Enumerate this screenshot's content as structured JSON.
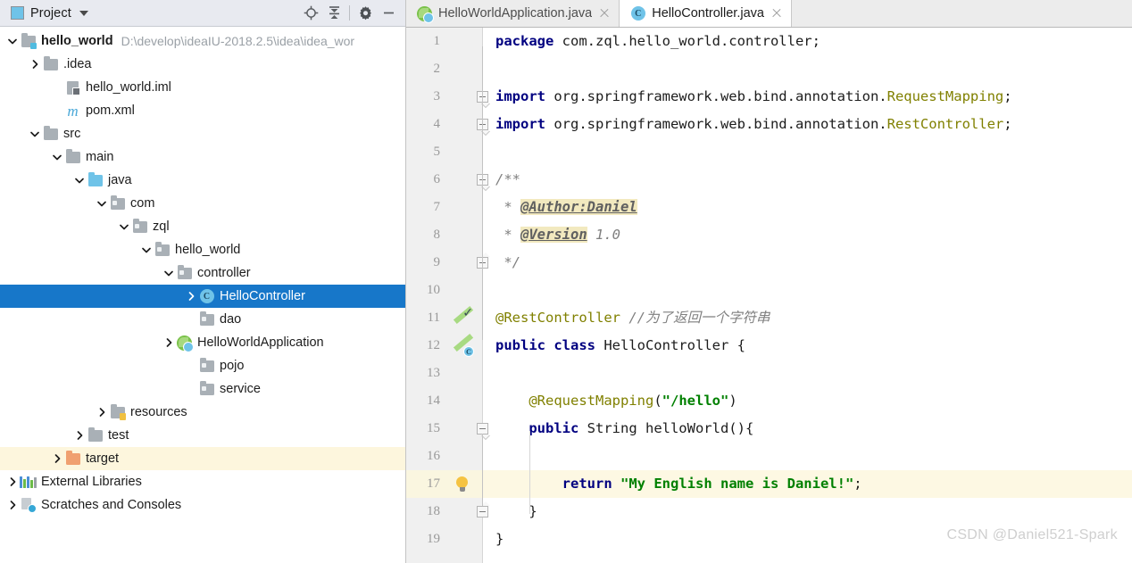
{
  "sidebar": {
    "title": "Project",
    "icon": "project-window-icon",
    "toolbar": [
      {
        "name": "locate-icon",
        "label": "Select Opened File"
      },
      {
        "name": "collapse-all-icon",
        "label": "Collapse All"
      },
      {
        "name": "gear-icon",
        "label": "Settings"
      },
      {
        "name": "minimize-icon",
        "label": "Hide"
      }
    ],
    "tree": [
      {
        "indent": 0,
        "arrow": "down",
        "icon": "module-folder-icon",
        "label": "hello_world",
        "bold": true,
        "path": "D:\\develop\\ideaIU-2018.2.5\\idea\\idea_wor",
        "state": "normal"
      },
      {
        "indent": 1,
        "arrow": "right",
        "icon": "folder-icon",
        "label": ".idea",
        "bold": false,
        "path": "",
        "state": "normal"
      },
      {
        "indent": 2,
        "arrow": "none",
        "icon": "iml-file-icon",
        "label": "hello_world.iml",
        "bold": false,
        "path": "",
        "state": "normal"
      },
      {
        "indent": 2,
        "arrow": "none",
        "icon": "maven-pom-icon",
        "label": "pom.xml",
        "bold": false,
        "path": "",
        "state": "normal"
      },
      {
        "indent": 1,
        "arrow": "down",
        "icon": "folder-icon",
        "label": "src",
        "bold": false,
        "path": "",
        "state": "normal"
      },
      {
        "indent": 2,
        "arrow": "down",
        "icon": "folder-icon",
        "label": "main",
        "bold": false,
        "path": "",
        "state": "normal"
      },
      {
        "indent": 3,
        "arrow": "down",
        "icon": "source-folder-icon",
        "label": "java",
        "bold": false,
        "path": "",
        "state": "normal"
      },
      {
        "indent": 4,
        "arrow": "down",
        "icon": "package-icon",
        "label": "com",
        "bold": false,
        "path": "",
        "state": "normal"
      },
      {
        "indent": 5,
        "arrow": "down",
        "icon": "package-icon",
        "label": "zql",
        "bold": false,
        "path": "",
        "state": "normal"
      },
      {
        "indent": 6,
        "arrow": "down",
        "icon": "package-icon",
        "label": "hello_world",
        "bold": false,
        "path": "",
        "state": "normal"
      },
      {
        "indent": 7,
        "arrow": "down",
        "icon": "package-icon",
        "label": "controller",
        "bold": false,
        "path": "",
        "state": "normal"
      },
      {
        "indent": 8,
        "arrow": "right",
        "icon": "java-class-icon",
        "label": "HelloController",
        "bold": false,
        "path": "",
        "state": "selected"
      },
      {
        "indent": 8,
        "arrow": "none",
        "icon": "package-icon",
        "label": "dao",
        "bold": false,
        "path": "",
        "state": "normal"
      },
      {
        "indent": 7,
        "arrow": "right",
        "icon": "spring-class-icon",
        "label": "HelloWorldApplication",
        "bold": false,
        "path": "",
        "state": "normal"
      },
      {
        "indent": 8,
        "arrow": "none",
        "icon": "package-icon",
        "label": "pojo",
        "bold": false,
        "path": "",
        "state": "normal"
      },
      {
        "indent": 8,
        "arrow": "none",
        "icon": "package-icon",
        "label": "service",
        "bold": false,
        "path": "",
        "state": "normal"
      },
      {
        "indent": 4,
        "arrow": "right",
        "icon": "resource-folder-icon",
        "label": "resources",
        "bold": false,
        "path": "",
        "state": "normal"
      },
      {
        "indent": 3,
        "arrow": "right",
        "icon": "folder-icon",
        "label": "test",
        "bold": false,
        "path": "",
        "state": "normal"
      },
      {
        "indent": 2,
        "arrow": "right",
        "icon": "excluded-folder-icon",
        "label": "target",
        "bold": false,
        "path": "",
        "state": "excluded"
      },
      {
        "indent": 0,
        "arrow": "right",
        "icon": "libraries-icon",
        "label": "External Libraries",
        "bold": false,
        "path": "",
        "state": "normal"
      },
      {
        "indent": 0,
        "arrow": "right",
        "icon": "scratches-icon",
        "label": "Scratches and Consoles",
        "bold": false,
        "path": "",
        "state": "normal"
      }
    ]
  },
  "editor": {
    "tabs": [
      {
        "label": "HelloWorldApplication.java",
        "icon": "spring-class-icon",
        "active": false
      },
      {
        "label": "HelloController.java",
        "icon": "java-class-icon",
        "active": true
      }
    ],
    "line_numbers": [
      1,
      2,
      3,
      4,
      5,
      6,
      7,
      8,
      9,
      10,
      11,
      12,
      13,
      14,
      15,
      16,
      17,
      18,
      19
    ],
    "lines": [
      {
        "n": 1,
        "tokens": [
          {
            "t": "kw",
            "v": "package"
          },
          {
            "t": "plain",
            "v": " com.zql.hello_world.controller;"
          }
        ]
      },
      {
        "n": 2,
        "tokens": []
      },
      {
        "n": 3,
        "tokens": [
          {
            "t": "kw",
            "v": "import"
          },
          {
            "t": "plain",
            "v": " org.springframework.web.bind.annotation."
          },
          {
            "t": "ann",
            "v": "RequestMapping"
          },
          {
            "t": "plain",
            "v": ";"
          }
        ]
      },
      {
        "n": 4,
        "tokens": [
          {
            "t": "kw",
            "v": "import"
          },
          {
            "t": "plain",
            "v": " org.springframework.web.bind.annotation."
          },
          {
            "t": "ann",
            "v": "RestController"
          },
          {
            "t": "plain",
            "v": ";"
          }
        ]
      },
      {
        "n": 5,
        "tokens": []
      },
      {
        "n": 6,
        "tokens": [
          {
            "t": "jdoc",
            "v": "/**"
          }
        ]
      },
      {
        "n": 7,
        "tokens": [
          {
            "t": "jdoc",
            "v": " * "
          },
          {
            "t": "jtag",
            "v": "@Author:Daniel"
          }
        ]
      },
      {
        "n": 8,
        "tokens": [
          {
            "t": "jdoc",
            "v": " * "
          },
          {
            "t": "jtag",
            "v": "@Version"
          },
          {
            "t": "jdocval",
            "v": " 1.0"
          }
        ]
      },
      {
        "n": 9,
        "tokens": [
          {
            "t": "jdoc",
            "v": " */"
          }
        ]
      },
      {
        "n": 10,
        "tokens": []
      },
      {
        "n": 11,
        "tokens": [
          {
            "t": "ann",
            "v": "@RestController"
          },
          {
            "t": "cmt",
            "v": " //为了返回一个字符串"
          }
        ]
      },
      {
        "n": 12,
        "tokens": [
          {
            "t": "kw",
            "v": "public class"
          },
          {
            "t": "plain",
            "v": " HelloController {"
          }
        ]
      },
      {
        "n": 13,
        "tokens": []
      },
      {
        "n": 14,
        "tokens": [
          {
            "t": "plain",
            "v": "    "
          },
          {
            "t": "ann",
            "v": "@RequestMapping"
          },
          {
            "t": "plain",
            "v": "("
          },
          {
            "t": "str",
            "v": "\"/hello\""
          },
          {
            "t": "plain",
            "v": ")"
          }
        ]
      },
      {
        "n": 15,
        "tokens": [
          {
            "t": "plain",
            "v": "    "
          },
          {
            "t": "kw",
            "v": "public"
          },
          {
            "t": "plain",
            "v": " String helloWorld(){"
          }
        ]
      },
      {
        "n": 16,
        "tokens": []
      },
      {
        "n": 17,
        "tokens": [
          {
            "t": "plain",
            "v": "        "
          },
          {
            "t": "kw",
            "v": "return"
          },
          {
            "t": "plain",
            "v": " "
          },
          {
            "t": "str",
            "v": "\"My English name is Daniel!\""
          },
          {
            "t": "plain",
            "v": ";"
          }
        ]
      },
      {
        "n": 18,
        "tokens": [
          {
            "t": "plain",
            "v": "    }"
          }
        ]
      },
      {
        "n": 19,
        "tokens": [
          {
            "t": "plain",
            "v": "}"
          }
        ]
      }
    ],
    "caret_line": 17,
    "gutter_markers": [
      {
        "line": 11,
        "name": "spring-bean-candidate-icon"
      },
      {
        "line": 12,
        "name": "spring-component-icon"
      },
      {
        "line": 17,
        "name": "intention-bulb-icon"
      }
    ],
    "watermark": "CSDN @Daniel521-Spark"
  },
  "colors": {
    "selection": "#1777c9",
    "caret_line": "#fdf8e3",
    "excluded_row": "#fdf6dd",
    "keyword": "#000080",
    "string": "#008000",
    "annotation": "#808000",
    "comment": "#808080",
    "javadoc_tag_bg": "#f2e9bf"
  }
}
